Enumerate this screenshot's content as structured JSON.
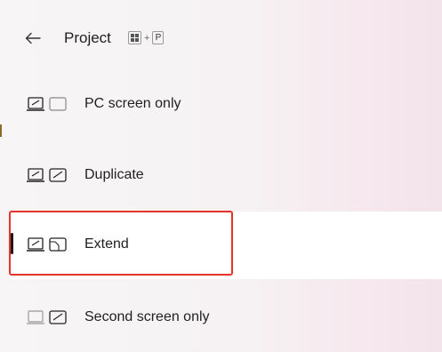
{
  "header": {
    "back_icon": "back-arrow-icon",
    "title": "Project",
    "shortcut": {
      "windows_key_icon": "windows-key-icon",
      "plus": "+",
      "key": "P"
    }
  },
  "options": [
    {
      "label": "PC screen only",
      "icon": "pc-screen-only-icon",
      "selected": false
    },
    {
      "label": "Duplicate",
      "icon": "duplicate-icon",
      "selected": false
    },
    {
      "label": "Extend",
      "icon": "extend-icon",
      "selected": true
    },
    {
      "label": "Second screen only",
      "icon": "second-screen-only-icon",
      "selected": false
    }
  ],
  "colors": {
    "highlight_border": "#e5332a",
    "selected_background": "#ffffff",
    "selected_indicator": "#1a1a1a"
  }
}
